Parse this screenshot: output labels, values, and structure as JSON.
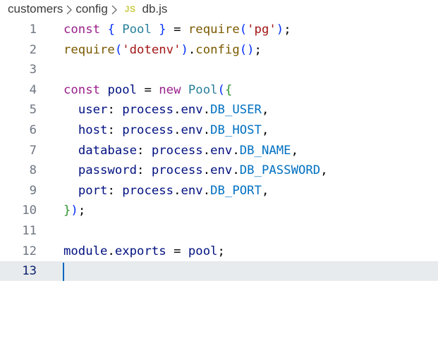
{
  "breadcrumb": {
    "items": [
      "customers",
      "config",
      "db.js"
    ],
    "file_icon_label": "JS"
  },
  "editor": {
    "language": "javascript",
    "cursor_line": 13,
    "lines": [
      {
        "num": "1",
        "text": "const { Pool } = require('pg');"
      },
      {
        "num": "2",
        "text": "require('dotenv').config();"
      },
      {
        "num": "3",
        "text": ""
      },
      {
        "num": "4",
        "text": "const pool = new Pool({"
      },
      {
        "num": "5",
        "text": "  user: process.env.DB_USER,"
      },
      {
        "num": "6",
        "text": "  host: process.env.DB_HOST,"
      },
      {
        "num": "7",
        "text": "  database: process.env.DB_NAME,"
      },
      {
        "num": "8",
        "text": "  password: process.env.DB_PASSWORD,"
      },
      {
        "num": "9",
        "text": "  port: process.env.DB_PORT,"
      },
      {
        "num": "10",
        "text": "});"
      },
      {
        "num": "11",
        "text": ""
      },
      {
        "num": "12",
        "text": "module.exports = pool;"
      },
      {
        "num": "13",
        "text": ""
      }
    ]
  },
  "colors": {
    "keyword": "#9a1f8a",
    "identifier": "#001080",
    "class": "#267f99",
    "function": "#7a5a00",
    "string": "#a31515",
    "constant": "#0070c1",
    "current_line": "#e8ebed",
    "cursor": "#0066bf",
    "js_icon": "#cbcb41"
  }
}
